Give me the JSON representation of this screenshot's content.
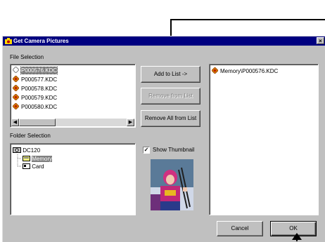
{
  "dialog": {
    "title": "Get Camera Pictures",
    "close_glyph": "×",
    "app_icon": "camera-icon"
  },
  "file_selection": {
    "label": "File Selection",
    "files": [
      {
        "name": "P000576.KDC",
        "selected": true
      },
      {
        "name": "P000577.KDC",
        "selected": false
      },
      {
        "name": "P000578.KDC",
        "selected": false
      },
      {
        "name": "P000579.KDC",
        "selected": false
      },
      {
        "name": "P000580.KDC",
        "selected": false
      }
    ],
    "scroll_left": "◀",
    "scroll_right": "▶"
  },
  "buttons": {
    "add": "Add to List ->",
    "remove": "Remove from List",
    "remove_all": "Remove All from List",
    "cancel": "Cancel",
    "ok": "OK"
  },
  "folder_selection": {
    "label": "Folder Selection",
    "root": "DC120",
    "children": [
      {
        "name": "Memory",
        "selected": true
      },
      {
        "name": "Card",
        "selected": false
      }
    ]
  },
  "thumbnail": {
    "show_label": "Show Thumbnail",
    "checked": true,
    "check_glyph": "✓"
  },
  "selected_list": {
    "items": [
      "Memory\\P000576.KDC"
    ]
  },
  "colors": {
    "title_bar": "#000080",
    "dialog_bg": "#c0c0c0",
    "arrow": "#000000"
  }
}
